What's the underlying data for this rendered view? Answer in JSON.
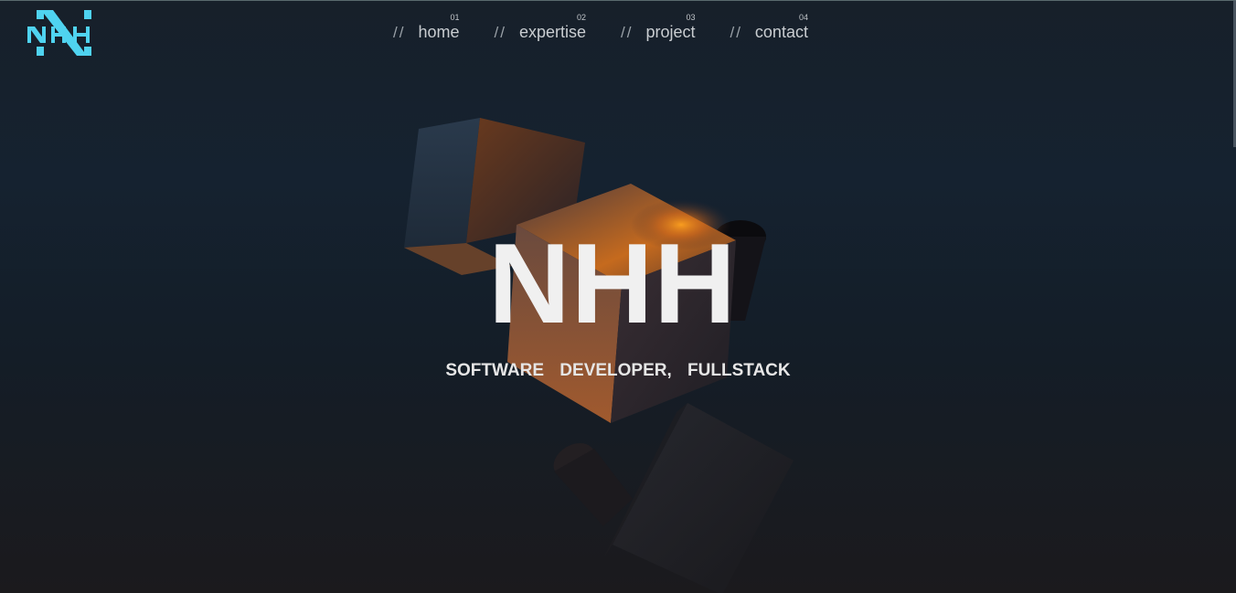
{
  "logo": {
    "text": "NHH",
    "color": "#4fd3f0"
  },
  "nav": {
    "items": [
      {
        "slash": "//",
        "label": "home",
        "num": "01"
      },
      {
        "slash": "//",
        "label": "expertise",
        "num": "02"
      },
      {
        "slash": "//",
        "label": "project",
        "num": "03"
      },
      {
        "slash": "//",
        "label": "contact",
        "num": "04"
      }
    ]
  },
  "hero": {
    "title": "NHH",
    "subtitle": "SOFTWARE DEVELOPER, FULLSTACK"
  },
  "colors": {
    "accent": "#4fd3f0",
    "background": "#141d27",
    "glow": "#f08a1a"
  }
}
